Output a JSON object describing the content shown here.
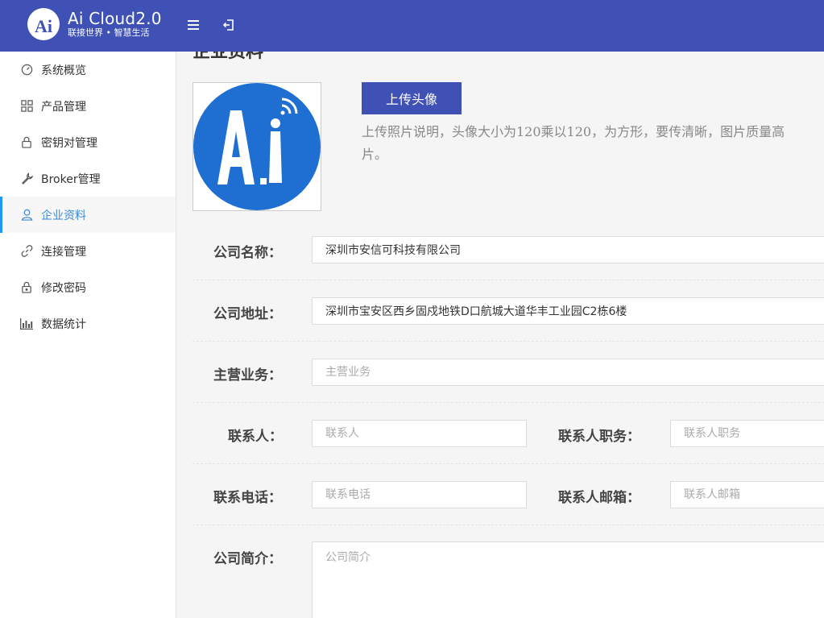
{
  "header": {
    "title": "Ai Cloud2.0",
    "subtitle": "联接世界 • 智慧生活",
    "logo_text": "Ai",
    "menu_icon": "menu-icon",
    "logout_icon": "logout-icon",
    "brand_color": "#3f51b5"
  },
  "sidebar": {
    "items": [
      {
        "label": "系统概览",
        "icon": "dashboard-icon"
      },
      {
        "label": "产品管理",
        "icon": "grid-icon"
      },
      {
        "label": "密钥对管理",
        "icon": "lock-icon"
      },
      {
        "label": "Broker管理",
        "icon": "wrench-icon"
      },
      {
        "label": "企业资料",
        "icon": "user-icon",
        "active": true
      },
      {
        "label": "连接管理",
        "icon": "link-icon"
      },
      {
        "label": "修改密码",
        "icon": "lock-icon"
      },
      {
        "label": "数据统计",
        "icon": "bar-chart-icon"
      }
    ]
  },
  "main": {
    "section_title": "企业资料",
    "upload_button": "上传头像",
    "upload_desc_line1": "上传照片说明，头像大小为120乘以120，为方形，要传清晰，图片质量高",
    "upload_desc_line2": "片。",
    "form": {
      "company_name": {
        "label": "公司名称：",
        "value": "深圳市安信可科技有限公司"
      },
      "company_address": {
        "label": "公司地址：",
        "value": "深圳市宝安区西乡固戍地铁D口航城大道华丰工业园C2栋6楼"
      },
      "main_business": {
        "label": "主营业务：",
        "placeholder": "主营业务"
      },
      "contact": {
        "label": "联系人：",
        "placeholder": "联系人"
      },
      "contact_title": {
        "label": "联系人职务：",
        "placeholder": "联系人职务"
      },
      "phone": {
        "label": "联系电话：",
        "placeholder": "联系电话"
      },
      "email": {
        "label": "联系人邮箱：",
        "placeholder": "联系人邮箱"
      },
      "intro": {
        "label": "公司简介：",
        "placeholder": "公司简介"
      }
    }
  }
}
